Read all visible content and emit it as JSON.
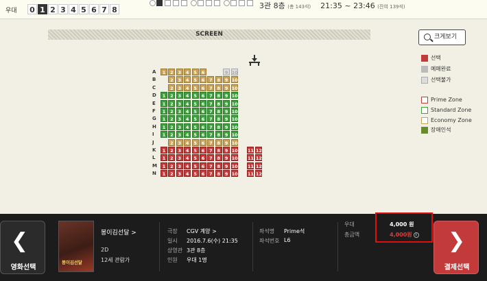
{
  "topbar": {
    "category_label": "우대",
    "counts": [
      "0",
      "1",
      "2",
      "3",
      "4",
      "5",
      "6",
      "7",
      "8"
    ],
    "selected_count": "1",
    "hall_text": "3관 8층",
    "hall_seats": "(총 143석)",
    "time_text": "21:35 ~ 23:46",
    "remaining": "(잔여 139석)"
  },
  "screen": {
    "label": "SCREEN"
  },
  "zoom_button": {
    "label": "크게보기"
  },
  "legend": {
    "selected": "선택",
    "booked": "예매완료",
    "unavailable": "선택불가",
    "prime": "Prime Zone",
    "standard": "Standard Zone",
    "economy": "Economy Zone",
    "disabled": "장애인석"
  },
  "seatmap": {
    "rows": [
      "A",
      "B",
      "C",
      "D",
      "E",
      "F",
      "G",
      "H",
      "I",
      "J",
      "K",
      "L",
      "M",
      "N"
    ],
    "side_seats": [
      "11",
      "12"
    ]
  },
  "movie": {
    "title": "봉이김선달 >",
    "format": "2D",
    "age": "12세 관람가",
    "poster_text": "봉이김선달"
  },
  "info": {
    "theater_k": "극장",
    "theater_v": "CGV 계양 >",
    "datetime_k": "일시",
    "datetime_v": "2016.7.6(수) 21:35",
    "hall_k": "상영관",
    "hall_v": "3관 8층",
    "people_k": "인원",
    "people_v": "우대 1명",
    "seatname_k": "좌석명",
    "seatname_v": "Prime석",
    "seatno_k": "좌석번호",
    "seatno_v": "L6"
  },
  "price": {
    "item_k": "우대",
    "item_v": "4,000 원",
    "total_k": "총금액",
    "total_v": "4,000원"
  },
  "nav": {
    "prev_label": "영화선택",
    "next_label": "결제선택"
  },
  "colors": {
    "accent": "#c23a3a",
    "prime": "#c23a3a",
    "standard": "#3e9e3e",
    "economy": "#c8a45a"
  }
}
